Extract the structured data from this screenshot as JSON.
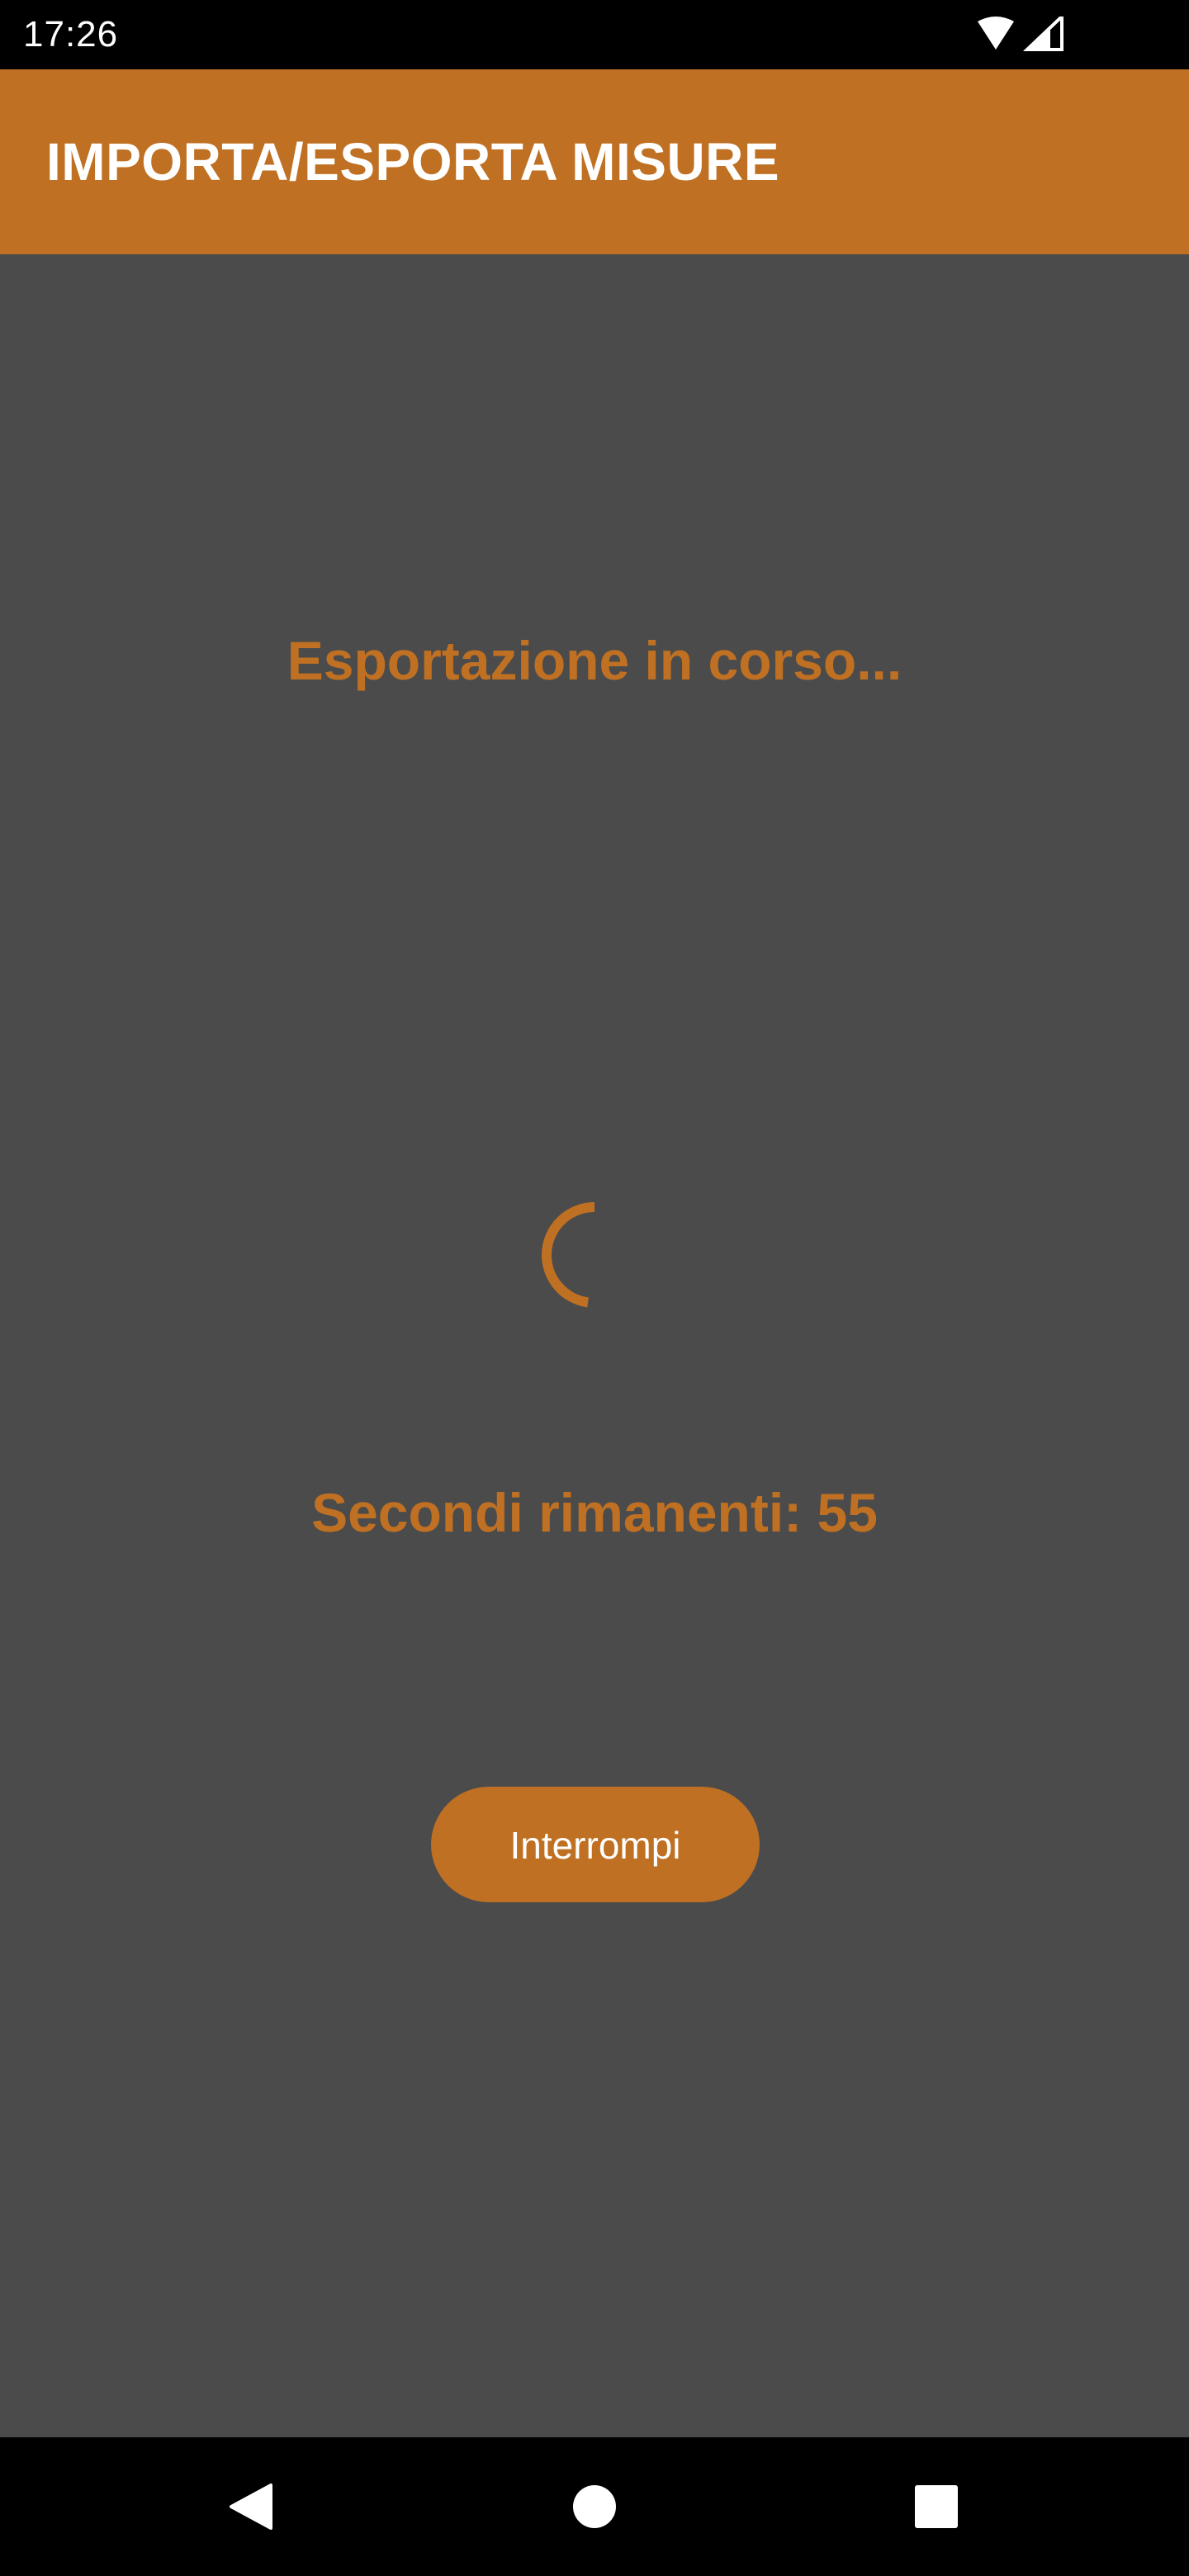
{
  "status_bar": {
    "time": "17:26",
    "icons": [
      "wifi-icon",
      "cell-signal-icon"
    ]
  },
  "app_bar": {
    "title": "IMPORTA/ESPORTA MISURE",
    "color": "#bf7022"
  },
  "main": {
    "status_message": "Esportazione in corso...",
    "remaining_text": "Secondi rimanenti: 55",
    "stop_button_label": "Interrompi"
  },
  "nav_bar": {
    "icons": [
      "back-icon",
      "home-icon",
      "recents-icon"
    ]
  },
  "colors": {
    "accent": "#bf7022",
    "background": "#4b4b4b",
    "bars": "#000000",
    "text_on_accent": "#ffffff"
  }
}
